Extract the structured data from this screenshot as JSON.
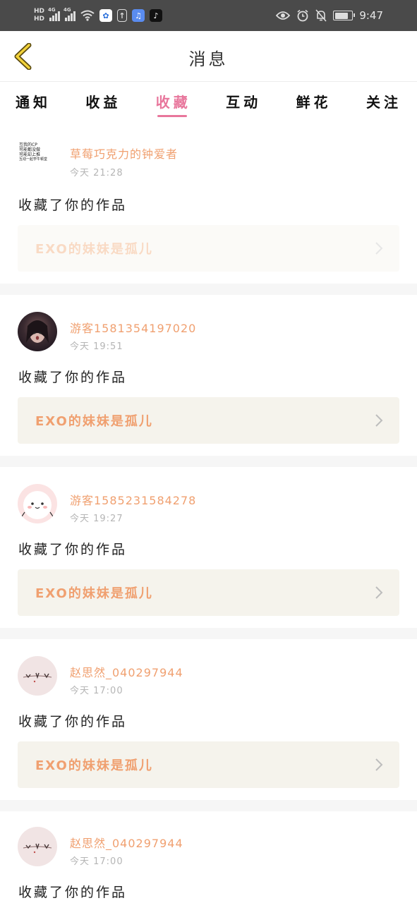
{
  "status_bar": {
    "left_labels": [
      "HD",
      "HD",
      "4G",
      "4G"
    ],
    "time": "9:47",
    "icons": [
      "hd-icon",
      "signal-icon",
      "wifi-icon",
      "baidu-app-icon",
      "upload-icon",
      "music-app-icon",
      "tiktok-app-icon",
      "eye-icon",
      "alarm-icon",
      "mute-bell-icon",
      "battery-icon"
    ]
  },
  "header": {
    "title": "消息"
  },
  "tabs": [
    {
      "label": "通知"
    },
    {
      "label": "收益"
    },
    {
      "label": "收藏"
    },
    {
      "label": "互动"
    },
    {
      "label": "鲜花"
    },
    {
      "label": "关注"
    }
  ],
  "active_tab_index": 2,
  "colors": {
    "accent": "#e8769c",
    "username": "#f0a070",
    "work_bg": "#f5f3ec",
    "separator": "#f6f6f6"
  },
  "messages": [
    {
      "avatar_text": [
        "互我的CP",
        "可能都没做",
        "可能却上推",
        "互动一起学牛顿堂"
      ],
      "username": "草莓巧克力的钟爱者",
      "time": "今天 21:28",
      "action": "收藏了你的作品",
      "work_title": "EXO的妹妹是孤儿"
    },
    {
      "username": "游客1581354197020",
      "time": "今天 19:51",
      "action": "收藏了你的作品",
      "work_title": "EXO的妹妹是孤儿"
    },
    {
      "username": "游客1585231584278",
      "time": "今天 19:27",
      "action": "收藏了你的作品",
      "work_title": "EXO的妹妹是孤儿"
    },
    {
      "username": "赵思然_040297944",
      "time": "今天 17:00",
      "action": "收藏了你的作品",
      "work_title": "EXO的妹妹是孤儿"
    },
    {
      "username": "赵思然_040297944",
      "time": "今天 17:00",
      "action": "收藏了你的作品"
    }
  ]
}
